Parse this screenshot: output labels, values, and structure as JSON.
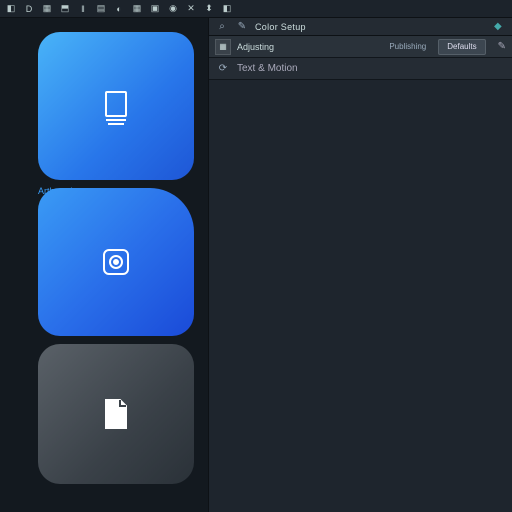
{
  "toolbar": {
    "items": [
      "◧",
      "D",
      "▦",
      "⬒",
      "‖",
      "▤",
      "◐",
      "▦",
      "▣",
      "◉",
      "✕",
      "⬍",
      "◧"
    ]
  },
  "panel": {
    "search_icon": "⌕",
    "wand_icon": "✎",
    "title": "Color Setup",
    "row1": {
      "icon": "▦",
      "label": "Adjusting",
      "tag": "Publishing",
      "button": "Defaults"
    },
    "row2": {
      "icon": "⟳",
      "label": "Text & Motion"
    }
  },
  "tiles": [
    {
      "style": "blue1",
      "icon": "document",
      "label": "Artboards"
    },
    {
      "style": "blue2",
      "icon": "target",
      "label": ""
    },
    {
      "style": "grey",
      "icon": "page",
      "label": ""
    }
  ],
  "strip": [
    "◆",
    "✎"
  ]
}
